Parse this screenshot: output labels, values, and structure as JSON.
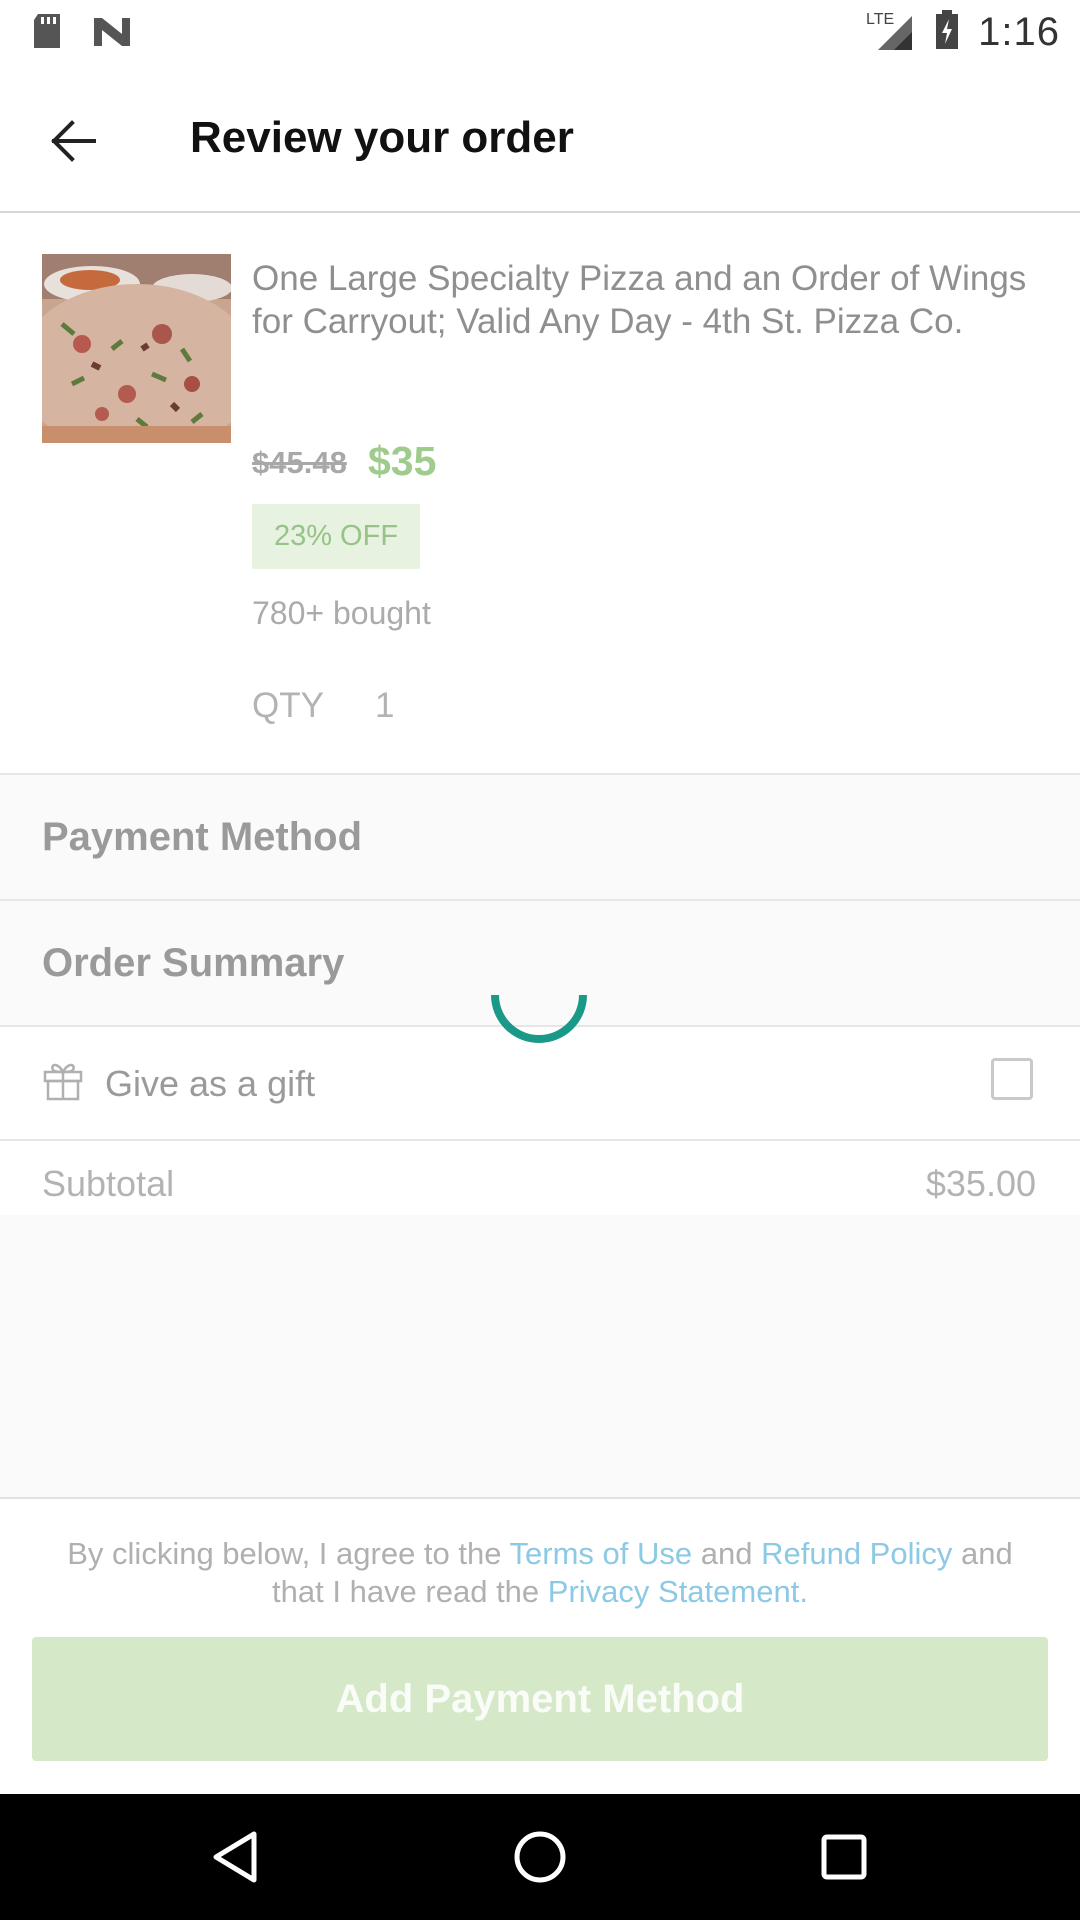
{
  "status_bar": {
    "time": "1:16",
    "network": "LTE"
  },
  "header": {
    "title": "Review your order"
  },
  "product": {
    "title": "One Large Specialty Pizza and an Order of Wings for Carryout; Valid Any Day - 4th St. Pizza Co.",
    "original_price": "$45.48",
    "price": "$35",
    "discount": "23% OFF",
    "bought": "780+ bought",
    "qty_label": "QTY",
    "qty_value": "1"
  },
  "sections": {
    "payment_method": "Payment Method",
    "order_summary": "Order Summary"
  },
  "gift": {
    "label": "Give as a gift",
    "checked": false
  },
  "summary": {
    "subtotal_label": "Subtotal",
    "subtotal_value": "$35.00"
  },
  "legal": {
    "part1": "By clicking below, I agree to the ",
    "terms": "Terms of Use",
    "part2": " and ",
    "refund": "Refund Policy",
    "part3": " and that I have read the ",
    "privacy": "Privacy Statement",
    "part4": "."
  },
  "cta": {
    "label": "Add Payment Method"
  },
  "colors": {
    "accent_green": "#53a318",
    "link_blue": "#1a9bd7",
    "spinner_teal": "#1a9988"
  }
}
